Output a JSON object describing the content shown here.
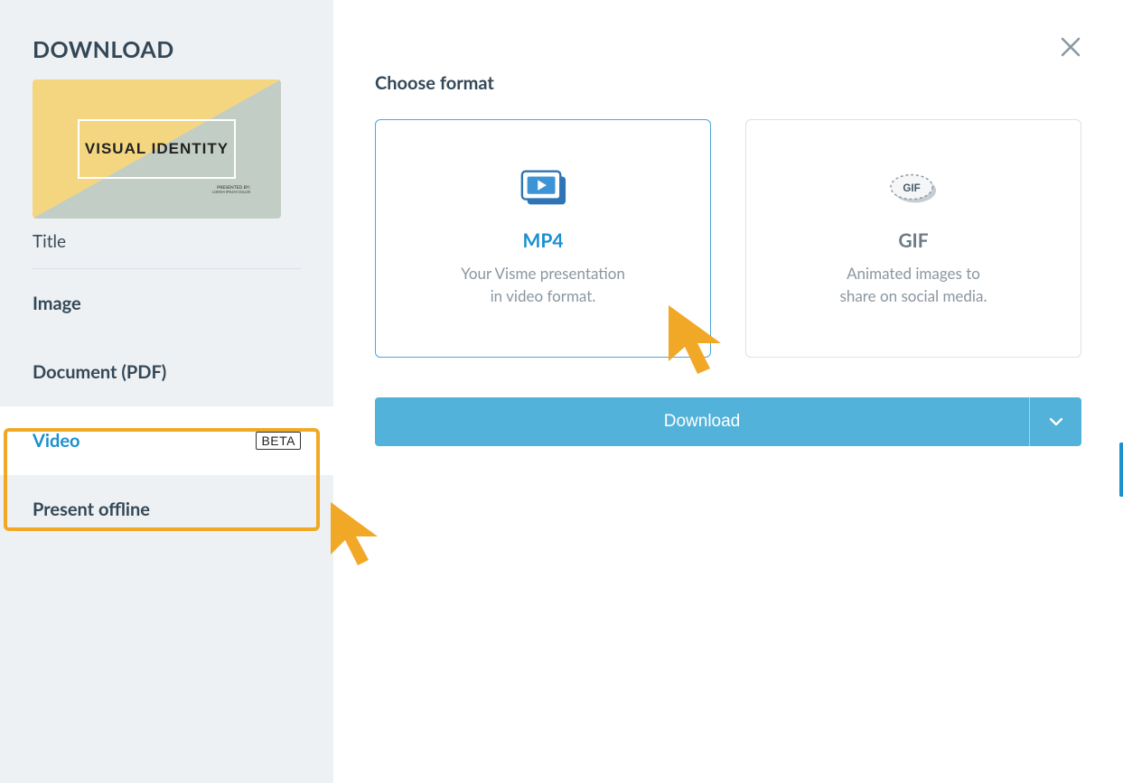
{
  "sidebar": {
    "heading": "DOWNLOAD",
    "thumbnail": {
      "title": "VISUAL IDENTITY",
      "sub1": "PRESENTED BY:",
      "sub2": "LOREM IPSUM DOLOR"
    },
    "title_label": "Title",
    "items": {
      "image": "Image",
      "document": "Document (PDF)",
      "video": "Video",
      "video_badge": "BETA",
      "present": "Present offline"
    }
  },
  "main": {
    "title": "Choose format",
    "formats": {
      "mp4": {
        "label": "MP4",
        "desc_line1": "Your Visme presentation",
        "desc_line2": "in video format."
      },
      "gif": {
        "label": "GIF",
        "icon_text": "GIF",
        "desc_line1": "Animated images to",
        "desc_line2": "share on social media."
      }
    },
    "download_button": "Download"
  }
}
